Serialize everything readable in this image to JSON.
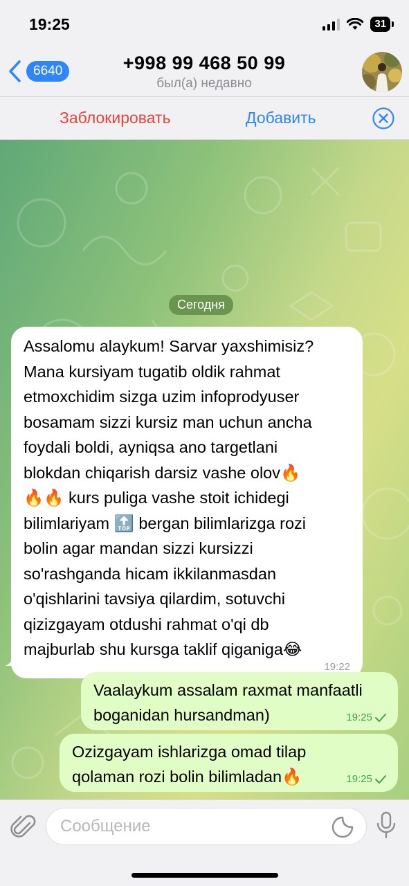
{
  "status_bar": {
    "time": "19:25",
    "battery": "31"
  },
  "header": {
    "back_badge": "6640",
    "contact_name": "+998 99 468 50 99",
    "contact_status": "был(а) недавно"
  },
  "action_bar": {
    "block_label": "Заблокировать",
    "add_label": "Добавить"
  },
  "chat": {
    "date_chip": "Сегодня",
    "messages": [
      {
        "direction": "incoming",
        "lines": [
          "Assalomu alaykum! Sarvar yaxshimisiz?",
          "Mana kursiyam tugatib oldik rahmat",
          "etmoxchidim sizga uzim infoprodyuser",
          "bosamam sizzi kursiz man uchun ancha",
          "foydali boldi, ayniqsa ano targetlani",
          "blokdan chiqarish darsiz vashe olov🔥",
          "🔥🔥 kurs puliga vashe stoit ichidegi",
          "bilimlariyam 🔝 bergan bilimlarizga rozi",
          "bolin agar mandan sizzi kursizzi",
          "so'rashganda hicam ikkilanmasdan",
          "o'qishlarini tavsiya qilardim, sotuvchi",
          "qizizgayam otdushi rahmat o'qi db",
          "majburlab shu kursga taklif qiganiga😂"
        ],
        "time": "19:22"
      },
      {
        "direction": "outgoing",
        "lines": [
          "Vaalaykum assalam raxmat manfaatli",
          "boganidan hursandman)"
        ],
        "time": "19:25"
      },
      {
        "direction": "outgoing",
        "lines": [
          "Ozizgayam ishlarizga omad tilap",
          "qolaman rozi bolin bilimladan🔥"
        ],
        "time": "19:25"
      }
    ]
  },
  "input": {
    "placeholder": "Сообщение"
  },
  "icons": {
    "back": "chevron-left-icon",
    "close": "close-circle-icon",
    "attach": "paperclip-icon",
    "sticker": "sticker-icon",
    "mic": "microphone-icon"
  },
  "colors": {
    "accent": "#2f86f6",
    "danger": "#e5443a",
    "outgoing_bubble": "#e1fdc6",
    "read_check": "#3ea34f"
  }
}
